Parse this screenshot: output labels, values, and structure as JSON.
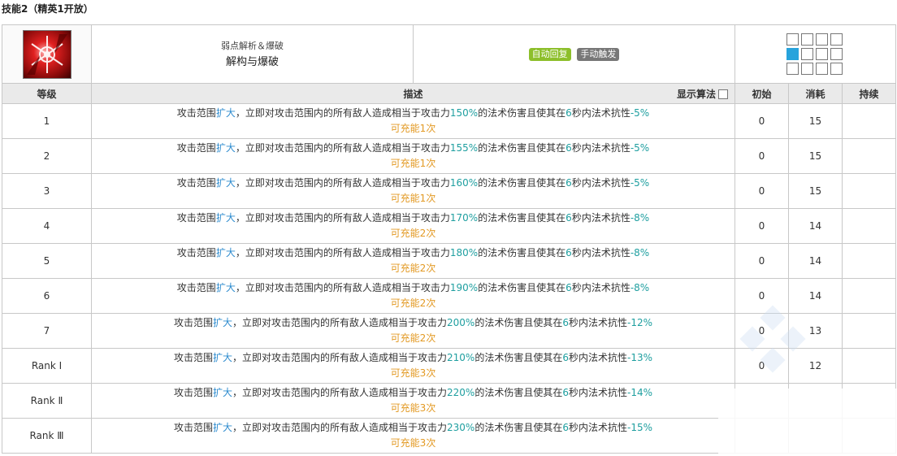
{
  "section_title": "技能2（精英1开放）",
  "skill": {
    "name_en": "弱点解析＆爆破",
    "name_cn": "解构与爆破",
    "tags": [
      "自动回复",
      "手动触发"
    ]
  },
  "columns": {
    "level": "等级",
    "description": "描述",
    "show_formula": "显示算法",
    "initial": "初始",
    "cost": "消耗",
    "duration": "持续"
  },
  "text": {
    "p1": "攻击范围",
    "p2": "扩大",
    "p3": "，立即对攻击范围内的所有敌人造成相当于攻击力",
    "p4": "的法术伤害且使其在",
    "p5": "6",
    "p6": "秒内法术抗性",
    "p7": "可充能",
    "p8": "次"
  },
  "levels": [
    {
      "level": "1",
      "mult": "150%",
      "res": "-5%",
      "charges": "1",
      "initial": "0",
      "cost": "15",
      "duration": ""
    },
    {
      "level": "2",
      "mult": "155%",
      "res": "-5%",
      "charges": "1",
      "initial": "0",
      "cost": "15",
      "duration": ""
    },
    {
      "level": "3",
      "mult": "160%",
      "res": "-5%",
      "charges": "1",
      "initial": "0",
      "cost": "15",
      "duration": ""
    },
    {
      "level": "4",
      "mult": "170%",
      "res": "-8%",
      "charges": "2",
      "initial": "0",
      "cost": "14",
      "duration": ""
    },
    {
      "level": "5",
      "mult": "180%",
      "res": "-8%",
      "charges": "2",
      "initial": "0",
      "cost": "14",
      "duration": ""
    },
    {
      "level": "6",
      "mult": "190%",
      "res": "-8%",
      "charges": "2",
      "initial": "0",
      "cost": "14",
      "duration": ""
    },
    {
      "level": "7",
      "mult": "200%",
      "res": "-12%",
      "charges": "2",
      "initial": "0",
      "cost": "13",
      "duration": ""
    },
    {
      "level": "Rank Ⅰ",
      "mult": "210%",
      "res": "-13%",
      "charges": "3",
      "initial": "0",
      "cost": "12",
      "duration": ""
    },
    {
      "level": "Rank Ⅱ",
      "mult": "220%",
      "res": "-14%",
      "charges": "3",
      "initial": "",
      "cost": "",
      "duration": ""
    },
    {
      "level": "Rank Ⅲ",
      "mult": "230%",
      "res": "-15%",
      "charges": "3",
      "initial": "",
      "cost": "",
      "duration": ""
    }
  ],
  "range_grid": {
    "rows": 3,
    "cols": 4,
    "self_cell": [
      1,
      0
    ]
  },
  "colors": {
    "highlight_blue": "#2e8ccf",
    "highlight_teal": "#1f9fa0",
    "highlight_orange": "#e39a24",
    "tag_auto": "#8dbf2b",
    "tag_manual": "#777777",
    "range_self": "#27a3dc"
  }
}
